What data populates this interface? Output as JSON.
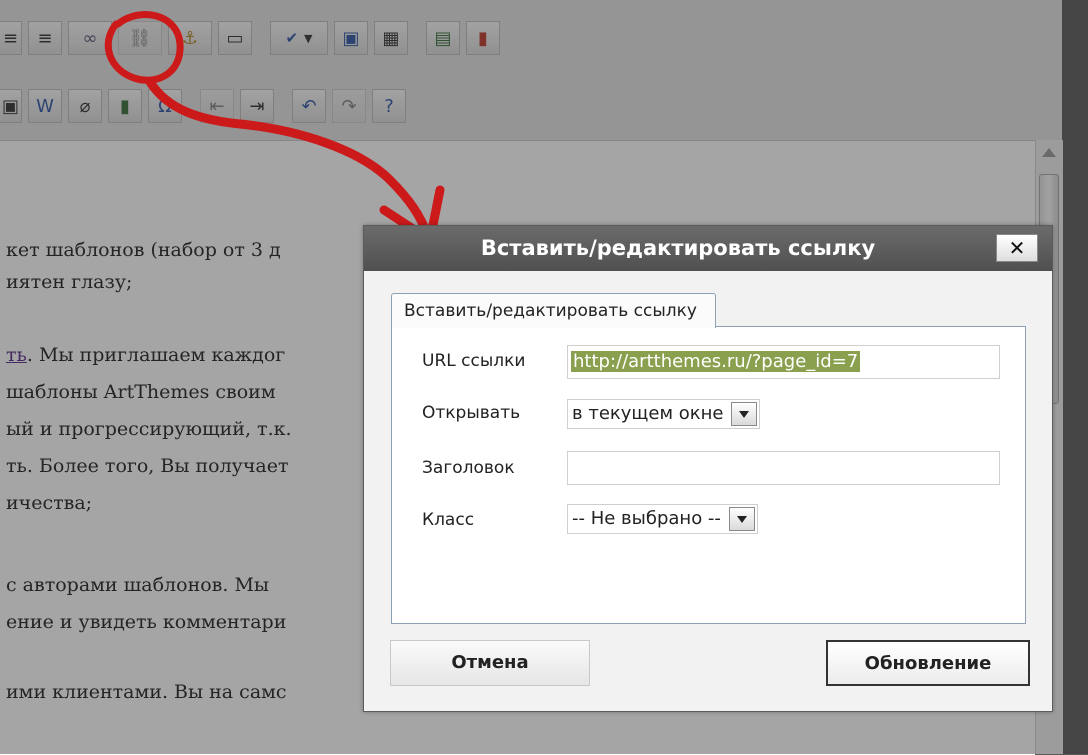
{
  "toolbar": {
    "row1": [
      "align-center-icon",
      "align-right-icon",
      "link-icon",
      "unlink-icon",
      "anchor-icon",
      "pagebreak-icon",
      "spellcheck-icon",
      "spellcheck-dropdown-icon",
      "fullscreen-icon",
      "table-icon",
      "template-icon",
      "chart-icon"
    ],
    "row2": [
      "paste-icon",
      "paste-word-icon",
      "clean-icon",
      "media-icon",
      "special-char-icon",
      "outdent-icon",
      "indent-icon",
      "undo-icon",
      "redo-icon",
      "help-icon"
    ]
  },
  "document": {
    "lines": [
      {
        "text": "кет шаблонов (набор от 3 д"
      },
      {
        "text": "иятен глазу;"
      },
      {
        "link": "ть",
        "text": ". Мы приглашаем каждог"
      },
      {
        "text": " шаблоны ArtThemes своим"
      },
      {
        "text": "ый и прогрессирующий, т.к."
      },
      {
        "text": "ть. Более того, Вы получает"
      },
      {
        "text": "ичества;"
      },
      {
        "text": "с авторами шаблонов. Мы"
      },
      {
        "text": "ение и увидеть комментари"
      },
      {
        "text": "ими клиентами. Вы на самс"
      }
    ]
  },
  "dialog": {
    "title": "Вставить/редактировать ссылку",
    "close_label": "✕",
    "tab_label": "Вставить/редактировать ссылку",
    "fields": {
      "url_label": "URL ссылки",
      "url_value": "http://artthemes.ru/?page_id=7",
      "target_label": "Открывать",
      "target_value": "в текущем окне",
      "title_label": "Заголовок",
      "title_value": "",
      "class_label": "Класс",
      "class_value": "-- Не выбрано --"
    },
    "cancel_label": "Отмена",
    "update_label": "Обновление"
  },
  "colors": {
    "annotation": "#cc1a1a",
    "title_bar": "#5a5a5a",
    "url_selection": "#8aa04e"
  }
}
